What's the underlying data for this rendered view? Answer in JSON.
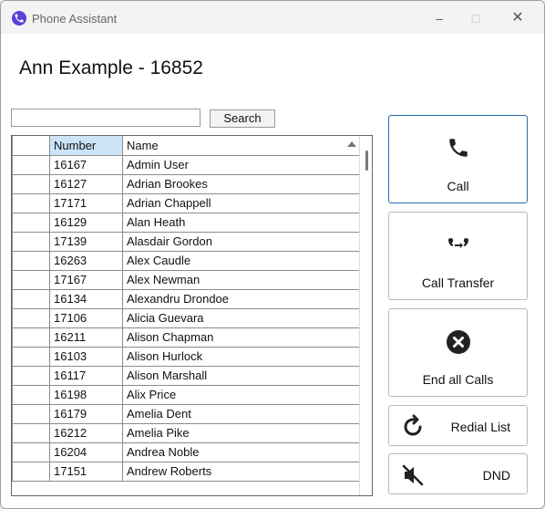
{
  "window": {
    "title": "Phone Assistant"
  },
  "header": {
    "name": "Ann Example",
    "separator": " - ",
    "extension": "16852"
  },
  "search": {
    "value": "",
    "button_label": "Search"
  },
  "table": {
    "columns": [
      "",
      "Number",
      "Name"
    ],
    "rows": [
      [
        "16167",
        "Admin User"
      ],
      [
        "16127",
        "Adrian Brookes"
      ],
      [
        "17171",
        "Adrian Chappell"
      ],
      [
        "16129",
        "Alan Heath"
      ],
      [
        "17139",
        "Alasdair Gordon"
      ],
      [
        "16263",
        "Alex Caudle"
      ],
      [
        "17167",
        "Alex Newman"
      ],
      [
        "16134",
        "Alexandru Drondoe"
      ],
      [
        "17106",
        "Alicia Guevara"
      ],
      [
        "16211",
        "Alison Chapman"
      ],
      [
        "16103",
        "Alison Hurlock"
      ],
      [
        "16117",
        "Alison Marshall"
      ],
      [
        "16198",
        "Alix Price"
      ],
      [
        "16179",
        "Amelia Dent"
      ],
      [
        "16212",
        "Amelia Pike"
      ],
      [
        "16204",
        "Andrea Noble"
      ],
      [
        "17151",
        "Andrew Roberts"
      ]
    ]
  },
  "actions": {
    "call": {
      "label": "Call",
      "icon": "phone-icon"
    },
    "transfer": {
      "label": "Call Transfer",
      "icon": "transfer-icon"
    },
    "end_all": {
      "label": "End all Calls",
      "icon": "close-circle-icon"
    },
    "redial": {
      "label": "Redial List",
      "icon": "redial-icon"
    },
    "dnd": {
      "label": "DND",
      "icon": "mute-icon"
    }
  },
  "colors": {
    "accent": "#2a6fb0",
    "brand": "#5b3fd6",
    "header_selected": "#cce4f7"
  }
}
